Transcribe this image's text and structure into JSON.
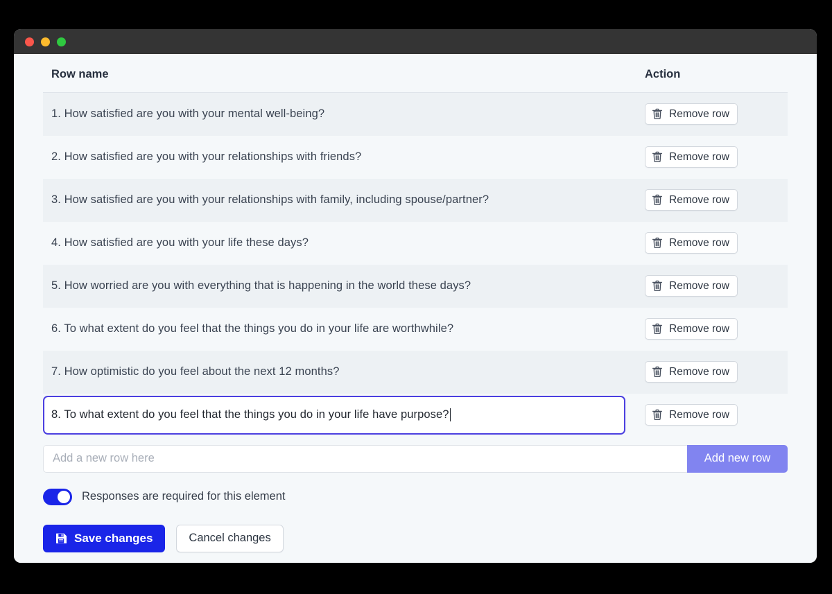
{
  "window": {
    "traffic_lights": [
      {
        "name": "close",
        "color": "#f9564b"
      },
      {
        "name": "minimize",
        "color": "#fcbb2d"
      },
      {
        "name": "maximize",
        "color": "#2fc940"
      }
    ]
  },
  "table": {
    "headers": {
      "row_name": "Row name",
      "action": "Action"
    },
    "remove_label": "Remove row",
    "rows": [
      {
        "text": "1. How satisfied are you with your mental well-being?",
        "editing": false
      },
      {
        "text": "2. How satisfied are you with your relationships with friends?",
        "editing": false
      },
      {
        "text": "3. How satisfied are you with your relationships with family, including spouse/partner?",
        "editing": false
      },
      {
        "text": "4. How satisfied are you with your life these days?",
        "editing": false
      },
      {
        "text": "5. How worried are you with everything that is happening in the world these days?",
        "editing": false
      },
      {
        "text": "6. To what extent do you feel that the things you do in your life are worthwhile?",
        "editing": false
      },
      {
        "text": "7. How optimistic do you feel about the next 12 months?",
        "editing": false
      },
      {
        "text": "8. To what extent do you feel that the things you do in your life have purpose?",
        "editing": true
      }
    ]
  },
  "add_row": {
    "placeholder": "Add a new row here",
    "value": "",
    "button_label": "Add new row",
    "button_color": "#8184f0"
  },
  "required_toggle": {
    "label": "Responses are required for this element",
    "state": "on",
    "color": "#1a25e8"
  },
  "footer": {
    "save_label": "Save changes",
    "cancel_label": "Cancel changes",
    "save_color": "#1a25e8"
  }
}
